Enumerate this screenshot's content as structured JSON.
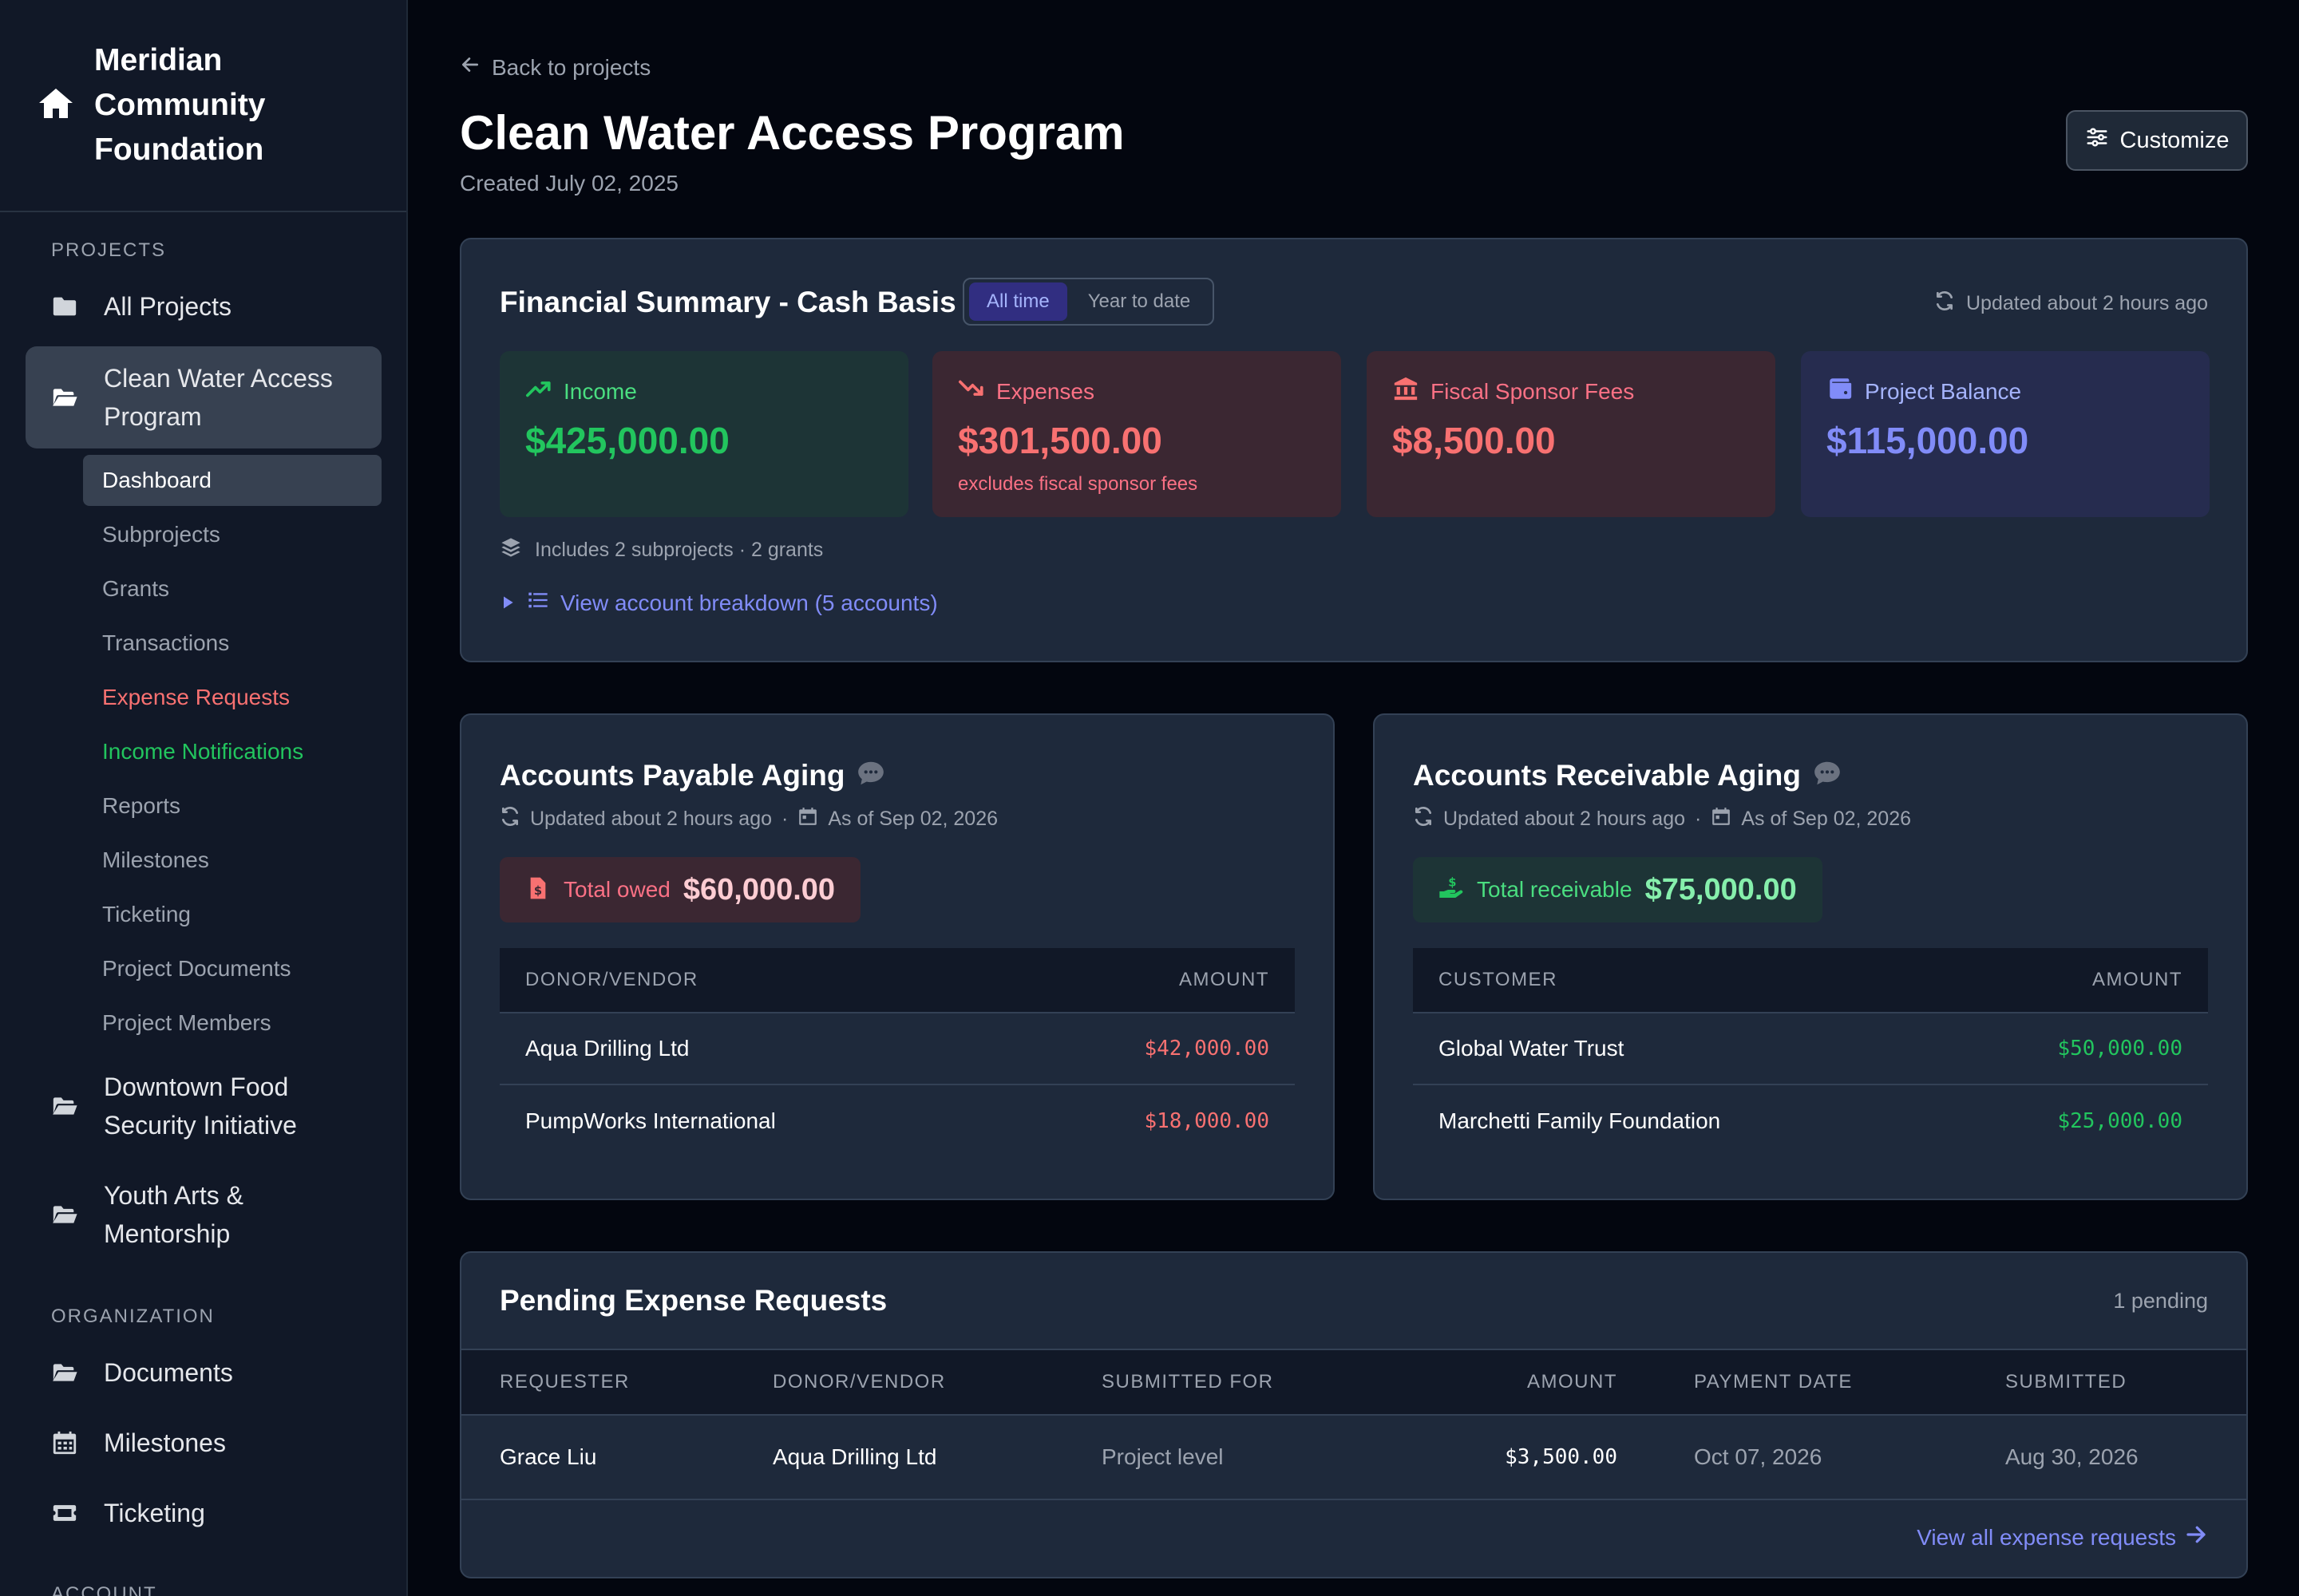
{
  "brand": {
    "name": "Meridian Community Foundation"
  },
  "sidebar": {
    "projects_label": "PROJECTS",
    "all_projects": "All Projects",
    "current_project": "Clean Water Access Program",
    "sub_items": [
      "Dashboard",
      "Subprojects",
      "Grants",
      "Transactions",
      "Expense Requests",
      "Income Notifications",
      "Reports",
      "Milestones",
      "Ticketing",
      "Project Documents",
      "Project Members"
    ],
    "other_projects": [
      "Downtown Food Security Initiative",
      "Youth Arts & Mentorship"
    ],
    "organization_label": "ORGANIZATION",
    "org_items": [
      "Documents",
      "Milestones",
      "Ticketing"
    ],
    "account_label": "ACCOUNT"
  },
  "header": {
    "back_link": "Back to projects",
    "title": "Clean Water Access Program",
    "created": "Created July 02, 2025",
    "customize": "Customize"
  },
  "financial_summary": {
    "title": "Financial Summary - Cash Basis",
    "toggle": [
      "All time",
      "Year to date"
    ],
    "selected_toggle": "All time",
    "updated": "Updated about 2 hours ago",
    "income": {
      "label": "Income",
      "value": "$425,000.00"
    },
    "expenses": {
      "label": "Expenses",
      "value": "$301,500.00",
      "note": "excludes fiscal sponsor fees"
    },
    "fees": {
      "label": "Fiscal Sponsor Fees",
      "value": "$8,500.00"
    },
    "balance": {
      "label": "Project Balance",
      "value": "$115,000.00"
    },
    "includes": "Includes 2 subprojects · 2 grants",
    "breakdown_link": "View account breakdown (5 accounts)"
  },
  "payable": {
    "title": "Accounts Payable Aging",
    "updated": "Updated about 2 hours ago",
    "sep": "·",
    "as_of": "As of Sep 02, 2026",
    "total_label": "Total owed",
    "total_value": "$60,000.00",
    "col_name": "DONOR/VENDOR",
    "col_amount": "AMOUNT",
    "rows": [
      {
        "name": "Aqua Drilling Ltd",
        "amount": "$42,000.00"
      },
      {
        "name": "PumpWorks International",
        "amount": "$18,000.00"
      }
    ]
  },
  "receivable": {
    "title": "Accounts Receivable Aging",
    "updated": "Updated about 2 hours ago",
    "sep": "·",
    "as_of": "As of Sep 02, 2026",
    "total_label": "Total receivable",
    "total_value": "$75,000.00",
    "col_name": "CUSTOMER",
    "col_amount": "AMOUNT",
    "rows": [
      {
        "name": "Global Water Trust",
        "amount": "$50,000.00"
      },
      {
        "name": "Marchetti Family Foundation",
        "amount": "$25,000.00"
      }
    ]
  },
  "pending": {
    "title": "Pending Expense Requests",
    "count": "1 pending",
    "columns": [
      "REQUESTER",
      "DONOR/VENDOR",
      "SUBMITTED FOR",
      "AMOUNT",
      "PAYMENT DATE",
      "SUBMITTED"
    ],
    "rows": [
      {
        "requester": "Grace Liu",
        "vendor": "Aqua Drilling Ltd",
        "submitted_for": "Project level",
        "amount": "$3,500.00",
        "payment_date": "Oct 07, 2026",
        "submitted": "Aug 30, 2026"
      }
    ],
    "view_all": "View all expense requests"
  },
  "colors": {
    "background": "#03060f",
    "sidebar": "#111827",
    "card": "#1e293b",
    "accent": "#818cf8",
    "positive": "#22c55e",
    "negative": "#f87171"
  }
}
